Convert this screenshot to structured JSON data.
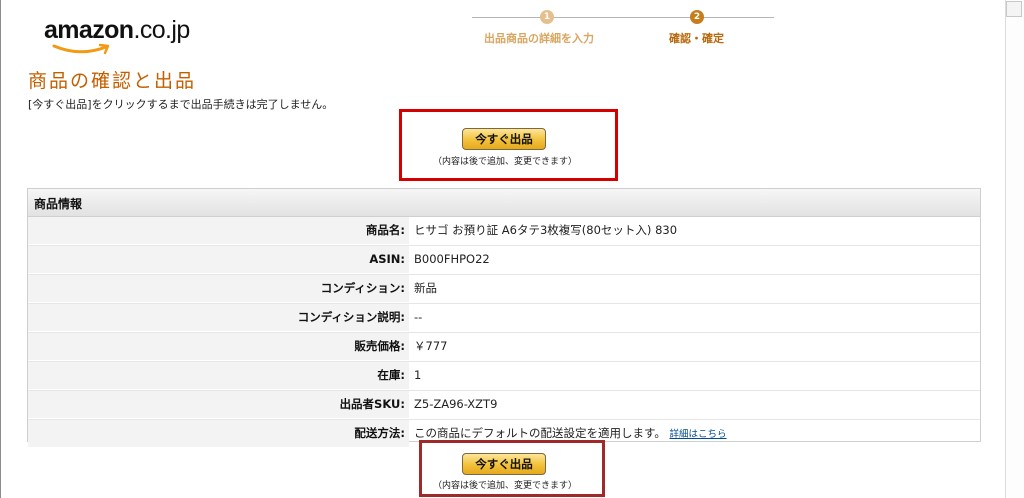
{
  "header": {
    "logo_main": "amazon",
    "logo_tld": ".co.jp",
    "steps": [
      {
        "number": "1",
        "label": "出品商品の詳細を入力"
      },
      {
        "number": "2",
        "label": "確認・確定"
      }
    ]
  },
  "page": {
    "title": "商品の確認と出品",
    "note": "[今すぐ出品]をクリックするまで出品手続きは完了しません。"
  },
  "actions": {
    "list_now_label": "今すぐ出品",
    "list_now_note": "（内容は後で追加、変更できます）"
  },
  "product_info": {
    "title": "商品情報",
    "rows": [
      {
        "label": "商品名:",
        "value": "ヒサゴ お預り証 A6タテ3枚複写(80セット入) 830"
      },
      {
        "label": "ASIN:",
        "value": "B000FHPO22"
      },
      {
        "label": "コンディション:",
        "value": "新品"
      },
      {
        "label": "コンディション説明:",
        "value": "--"
      },
      {
        "label": "販売価格:",
        "value": "￥777"
      },
      {
        "label": "在庫:",
        "value": "1"
      },
      {
        "label": "出品者SKU:",
        "value": "Z5-ZA96-XZT9"
      },
      {
        "label": "配送方法:",
        "value": "この商品にデフォルトの配送設定を適用します。",
        "link": "詳細はこちら"
      }
    ]
  },
  "colors": {
    "accent": "#c45f00",
    "highlight_border": "#d40000",
    "button_gold": "#f2c13a",
    "link": "#004b91"
  }
}
